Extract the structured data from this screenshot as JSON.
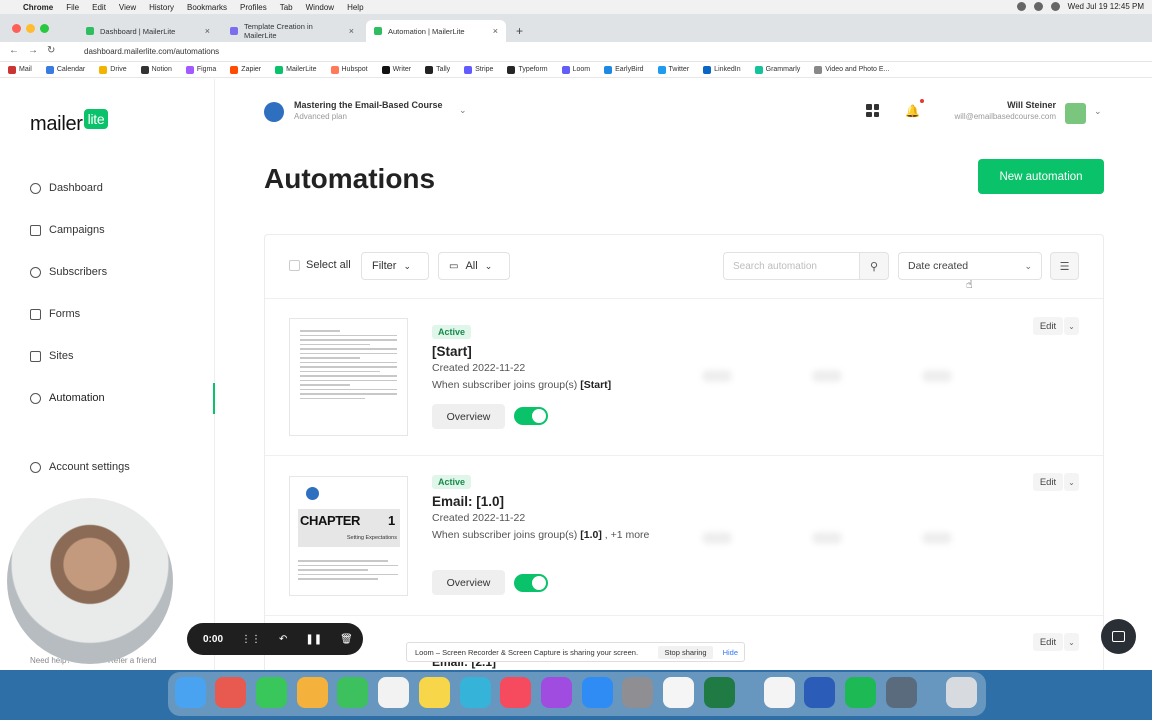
{
  "menubar": {
    "app": "Chrome",
    "items": [
      "File",
      "Edit",
      "View",
      "History",
      "Bookmarks",
      "Profiles",
      "Tab",
      "Window",
      "Help"
    ],
    "clock": "Wed Jul 19  12:45 PM"
  },
  "browser": {
    "tabs": [
      {
        "label": "Dashboard | MailerLite"
      },
      {
        "label": "Template Creation in MailerLite"
      },
      {
        "label": "Automation | MailerLite"
      }
    ],
    "url": "dashboard.mailerlite.com/automations",
    "bookmarks": [
      "Mail",
      "Calendar",
      "Drive",
      "Notion",
      "Figma",
      "Zapier",
      "MailerLite",
      "Hubspot",
      "Writer",
      "Tally",
      "Stripe",
      "Typeform",
      "Loom",
      "EarlyBird",
      "Twitter",
      "LinkedIn",
      "Grammarly",
      "Video and Photo E..."
    ]
  },
  "logo": {
    "text": "mailer",
    "badge": "lite"
  },
  "sidebar": {
    "items": [
      {
        "label": "Dashboard"
      },
      {
        "label": "Campaigns"
      },
      {
        "label": "Subscribers"
      },
      {
        "label": "Forms"
      },
      {
        "label": "Sites"
      },
      {
        "label": "Automation"
      },
      {
        "label": "Account settings"
      }
    ],
    "footer_help": "Need help?",
    "footer_refer": "Refer a friend"
  },
  "account": {
    "name": "Mastering the Email-Based Course",
    "plan": "Advanced plan"
  },
  "user": {
    "name": "Will Steiner",
    "email": "will@emailbasedcourse.com"
  },
  "page": {
    "title": "Automations",
    "new_button": "New automation"
  },
  "toolbar": {
    "select_all": "Select all",
    "filter": "Filter",
    "folder": "All",
    "search_placeholder": "Search automation",
    "sort": "Date created"
  },
  "automations": [
    {
      "status": "Active",
      "title": "[Start]",
      "created": "Created 2022-11-22",
      "trigger_prefix": "When subscriber joins group(s) ",
      "trigger_group": "[Start]",
      "trigger_more": "",
      "overview": "Overview",
      "edit": "Edit"
    },
    {
      "status": "Active",
      "title": "Email: [1.0]",
      "created": "Created 2022-11-22",
      "trigger_prefix": "When subscriber joins group(s) ",
      "trigger_group": "[1.0]",
      "trigger_more": " , +1 more",
      "overview": "Overview",
      "edit": "Edit",
      "thumb_heading": "CHAPTER",
      "thumb_number": "1",
      "thumb_sub": "Setting Expectations"
    },
    {
      "title": "Email: [2.1]",
      "edit": "Edit"
    }
  ],
  "recorder": {
    "time": "0:00"
  },
  "loom": {
    "message": "Loom – Screen Recorder & Screen Capture is sharing your screen.",
    "stop": "Stop sharing",
    "hide": "Hide"
  },
  "colors": {
    "brand": "#09c269",
    "dock": "#2d6fa6"
  }
}
